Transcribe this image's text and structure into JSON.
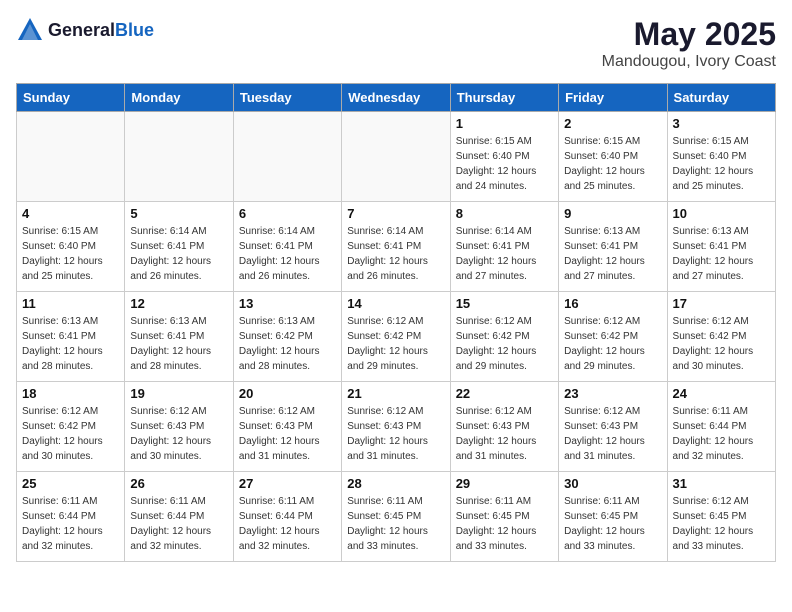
{
  "logo": {
    "general": "General",
    "blue": "Blue"
  },
  "header": {
    "month": "May 2025",
    "location": "Mandougou, Ivory Coast"
  },
  "weekdays": [
    "Sunday",
    "Monday",
    "Tuesday",
    "Wednesday",
    "Thursday",
    "Friday",
    "Saturday"
  ],
  "weeks": [
    [
      {
        "day": "",
        "sunrise": "",
        "sunset": "",
        "daylight": ""
      },
      {
        "day": "",
        "sunrise": "",
        "sunset": "",
        "daylight": ""
      },
      {
        "day": "",
        "sunrise": "",
        "sunset": "",
        "daylight": ""
      },
      {
        "day": "",
        "sunrise": "",
        "sunset": "",
        "daylight": ""
      },
      {
        "day": "1",
        "sunrise": "Sunrise: 6:15 AM",
        "sunset": "Sunset: 6:40 PM",
        "daylight": "Daylight: 12 hours and 24 minutes."
      },
      {
        "day": "2",
        "sunrise": "Sunrise: 6:15 AM",
        "sunset": "Sunset: 6:40 PM",
        "daylight": "Daylight: 12 hours and 25 minutes."
      },
      {
        "day": "3",
        "sunrise": "Sunrise: 6:15 AM",
        "sunset": "Sunset: 6:40 PM",
        "daylight": "Daylight: 12 hours and 25 minutes."
      }
    ],
    [
      {
        "day": "4",
        "sunrise": "Sunrise: 6:15 AM",
        "sunset": "Sunset: 6:40 PM",
        "daylight": "Daylight: 12 hours and 25 minutes."
      },
      {
        "day": "5",
        "sunrise": "Sunrise: 6:14 AM",
        "sunset": "Sunset: 6:41 PM",
        "daylight": "Daylight: 12 hours and 26 minutes."
      },
      {
        "day": "6",
        "sunrise": "Sunrise: 6:14 AM",
        "sunset": "Sunset: 6:41 PM",
        "daylight": "Daylight: 12 hours and 26 minutes."
      },
      {
        "day": "7",
        "sunrise": "Sunrise: 6:14 AM",
        "sunset": "Sunset: 6:41 PM",
        "daylight": "Daylight: 12 hours and 26 minutes."
      },
      {
        "day": "8",
        "sunrise": "Sunrise: 6:14 AM",
        "sunset": "Sunset: 6:41 PM",
        "daylight": "Daylight: 12 hours and 27 minutes."
      },
      {
        "day": "9",
        "sunrise": "Sunrise: 6:13 AM",
        "sunset": "Sunset: 6:41 PM",
        "daylight": "Daylight: 12 hours and 27 minutes."
      },
      {
        "day": "10",
        "sunrise": "Sunrise: 6:13 AM",
        "sunset": "Sunset: 6:41 PM",
        "daylight": "Daylight: 12 hours and 27 minutes."
      }
    ],
    [
      {
        "day": "11",
        "sunrise": "Sunrise: 6:13 AM",
        "sunset": "Sunset: 6:41 PM",
        "daylight": "Daylight: 12 hours and 28 minutes."
      },
      {
        "day": "12",
        "sunrise": "Sunrise: 6:13 AM",
        "sunset": "Sunset: 6:41 PM",
        "daylight": "Daylight: 12 hours and 28 minutes."
      },
      {
        "day": "13",
        "sunrise": "Sunrise: 6:13 AM",
        "sunset": "Sunset: 6:42 PM",
        "daylight": "Daylight: 12 hours and 28 minutes."
      },
      {
        "day": "14",
        "sunrise": "Sunrise: 6:12 AM",
        "sunset": "Sunset: 6:42 PM",
        "daylight": "Daylight: 12 hours and 29 minutes."
      },
      {
        "day": "15",
        "sunrise": "Sunrise: 6:12 AM",
        "sunset": "Sunset: 6:42 PM",
        "daylight": "Daylight: 12 hours and 29 minutes."
      },
      {
        "day": "16",
        "sunrise": "Sunrise: 6:12 AM",
        "sunset": "Sunset: 6:42 PM",
        "daylight": "Daylight: 12 hours and 29 minutes."
      },
      {
        "day": "17",
        "sunrise": "Sunrise: 6:12 AM",
        "sunset": "Sunset: 6:42 PM",
        "daylight": "Daylight: 12 hours and 30 minutes."
      }
    ],
    [
      {
        "day": "18",
        "sunrise": "Sunrise: 6:12 AM",
        "sunset": "Sunset: 6:42 PM",
        "daylight": "Daylight: 12 hours and 30 minutes."
      },
      {
        "day": "19",
        "sunrise": "Sunrise: 6:12 AM",
        "sunset": "Sunset: 6:43 PM",
        "daylight": "Daylight: 12 hours and 30 minutes."
      },
      {
        "day": "20",
        "sunrise": "Sunrise: 6:12 AM",
        "sunset": "Sunset: 6:43 PM",
        "daylight": "Daylight: 12 hours and 31 minutes."
      },
      {
        "day": "21",
        "sunrise": "Sunrise: 6:12 AM",
        "sunset": "Sunset: 6:43 PM",
        "daylight": "Daylight: 12 hours and 31 minutes."
      },
      {
        "day": "22",
        "sunrise": "Sunrise: 6:12 AM",
        "sunset": "Sunset: 6:43 PM",
        "daylight": "Daylight: 12 hours and 31 minutes."
      },
      {
        "day": "23",
        "sunrise": "Sunrise: 6:12 AM",
        "sunset": "Sunset: 6:43 PM",
        "daylight": "Daylight: 12 hours and 31 minutes."
      },
      {
        "day": "24",
        "sunrise": "Sunrise: 6:11 AM",
        "sunset": "Sunset: 6:44 PM",
        "daylight": "Daylight: 12 hours and 32 minutes."
      }
    ],
    [
      {
        "day": "25",
        "sunrise": "Sunrise: 6:11 AM",
        "sunset": "Sunset: 6:44 PM",
        "daylight": "Daylight: 12 hours and 32 minutes."
      },
      {
        "day": "26",
        "sunrise": "Sunrise: 6:11 AM",
        "sunset": "Sunset: 6:44 PM",
        "daylight": "Daylight: 12 hours and 32 minutes."
      },
      {
        "day": "27",
        "sunrise": "Sunrise: 6:11 AM",
        "sunset": "Sunset: 6:44 PM",
        "daylight": "Daylight: 12 hours and 32 minutes."
      },
      {
        "day": "28",
        "sunrise": "Sunrise: 6:11 AM",
        "sunset": "Sunset: 6:45 PM",
        "daylight": "Daylight: 12 hours and 33 minutes."
      },
      {
        "day": "29",
        "sunrise": "Sunrise: 6:11 AM",
        "sunset": "Sunset: 6:45 PM",
        "daylight": "Daylight: 12 hours and 33 minutes."
      },
      {
        "day": "30",
        "sunrise": "Sunrise: 6:11 AM",
        "sunset": "Sunset: 6:45 PM",
        "daylight": "Daylight: 12 hours and 33 minutes."
      },
      {
        "day": "31",
        "sunrise": "Sunrise: 6:12 AM",
        "sunset": "Sunset: 6:45 PM",
        "daylight": "Daylight: 12 hours and 33 minutes."
      }
    ]
  ]
}
